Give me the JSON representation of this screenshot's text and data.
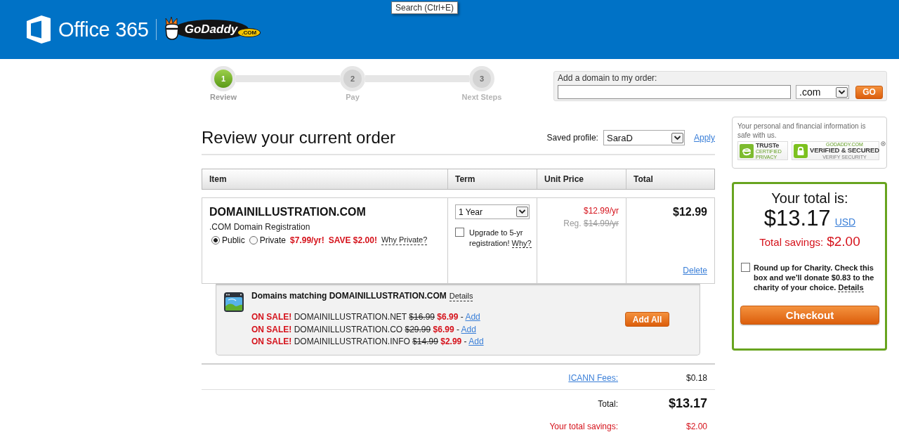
{
  "header": {
    "product": "Office 365",
    "partner_logo": {
      "wordmark": "GoDaddy",
      "suffix": ".COM"
    }
  },
  "tooltip": "Search (Ctrl+E)",
  "steps": [
    {
      "number": "1",
      "label": "Review",
      "selected": true
    },
    {
      "number": "2",
      "label": "Pay",
      "selected": false
    },
    {
      "number": "3",
      "label": "Next Steps",
      "selected": false
    }
  ],
  "add_domain": {
    "label": "Add a domain to my order:",
    "tld": ".com",
    "button": "GO"
  },
  "page_title": "Review your current order",
  "saved_profile": {
    "label": "Saved profile:",
    "value": "SaraD",
    "action": "Apply"
  },
  "table": {
    "columns": [
      "Item",
      "Term",
      "Unit Price",
      "Total"
    ],
    "rows": [
      {
        "name": "DOMAINILLUSTRATION.COM",
        "description": ".COM Domain Registration",
        "privacy_options": [
          {
            "label": "Public",
            "selected": true
          },
          {
            "label": "Private",
            "selected": false
          }
        ],
        "private_price": "$7.99/yr!",
        "private_saving": "SAVE $2.00!",
        "why_private": "Why Private?",
        "term": "1 Year",
        "upgrade": {
          "checked": false,
          "text": "Upgrade to 5-yr registration!",
          "why": "Why?"
        },
        "unit_price": "$12.99/yr",
        "regular_label": "Reg.",
        "regular_price": "$14.99/yr",
        "total": "$12.99",
        "delete": "Delete"
      }
    ]
  },
  "matching": {
    "title": "Domains matching DOMAINILLUSTRATION.COM",
    "details": "Details",
    "offers": [
      {
        "badge": "ON SALE!",
        "domain": "DOMAINILLUSTRATION.NET",
        "old_price": "$16.99",
        "price": "$6.99",
        "separator": "-",
        "add": "Add"
      },
      {
        "badge": "ON SALE!",
        "domain": "DOMAINILLUSTRATION.CO",
        "old_price": "$29.99",
        "price": "$6.99",
        "separator": "-",
        "add": "Add"
      },
      {
        "badge": "ON SALE!",
        "domain": "DOMAINILLUSTRATION.INFO",
        "old_price": "$14.99",
        "price": "$2.99",
        "separator": "-",
        "add": "Add"
      }
    ],
    "add_all": "Add All"
  },
  "summary": [
    {
      "kind": "link",
      "label": "ICANN Fees:",
      "value": "$0.18"
    },
    {
      "kind": "total",
      "label": "Total:",
      "value": "$13.17"
    },
    {
      "kind": "savings",
      "label": "Your total savings:",
      "value": "$2.00"
    }
  ],
  "security": {
    "text": "Your personal and financial information is safe with us.",
    "badges": [
      {
        "kind": "truste",
        "title": "TRUSTe",
        "subtitle": "CERTIFIED PRIVACY"
      },
      {
        "kind": "verified",
        "overline": "GODADDY.COM",
        "title": "VERIFIED & SECURED",
        "subtitle": "VERIFY SECURITY"
      }
    ]
  },
  "total_box": {
    "label": "Your total is:",
    "amount": "$13.17",
    "currency": "USD",
    "savings_label": "Total savings:",
    "savings": "$2.00",
    "charity": {
      "checked": false,
      "text": "Round up for Charity. Check this box and we'll donate $0.83 to the charity of your choice.",
      "details": "Details"
    },
    "checkout": "Checkout"
  }
}
